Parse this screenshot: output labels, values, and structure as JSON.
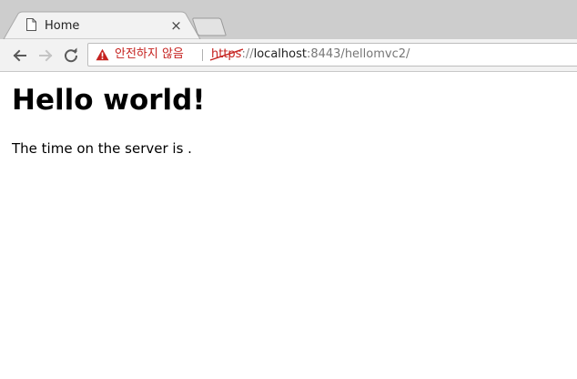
{
  "tab": {
    "title": "Home",
    "close_glyph": "×",
    "icon": "page-icon"
  },
  "toolbar": {
    "back_icon": "arrow-left-icon",
    "forward_icon": "arrow-right-icon",
    "reload_icon": "reload-icon"
  },
  "omnibox": {
    "security_icon": "warning-triangle-icon",
    "security_label": "안전하지 않음",
    "url_scheme": "https",
    "url_separator": "://",
    "url_host": "localhost",
    "url_rest": ":8443/hellomvc2/"
  },
  "page": {
    "heading": "Hello world!",
    "server_time_text": "The time on the server is ."
  },
  "colors": {
    "tabstrip": "#cdcdcd",
    "toolbar": "#f2f2f2",
    "insecure_red": "#c5221f"
  }
}
